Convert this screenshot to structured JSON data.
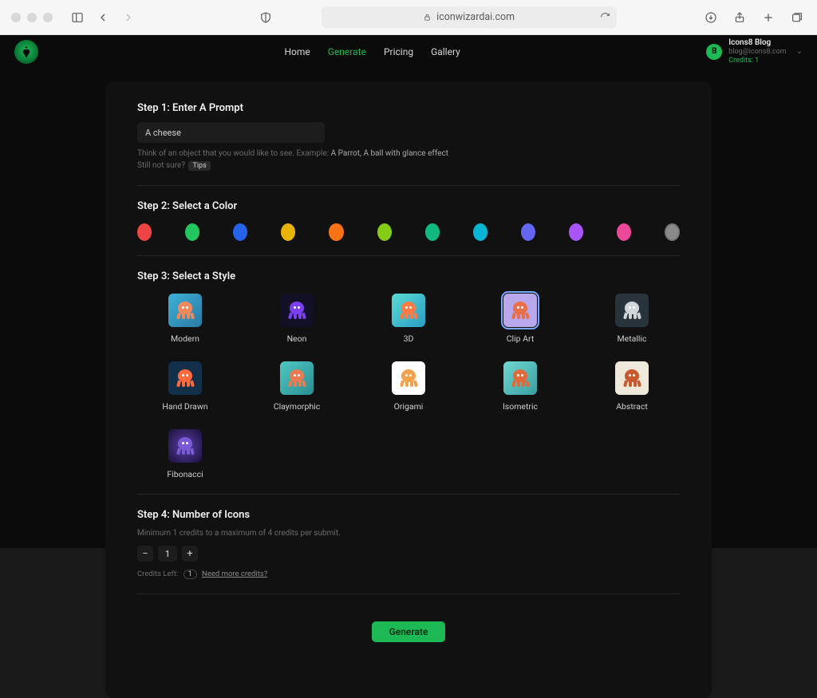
{
  "browser": {
    "url_host": "iconwizardai.com"
  },
  "nav": {
    "items": [
      {
        "label": "Home"
      },
      {
        "label": "Generate"
      },
      {
        "label": "Pricing"
      },
      {
        "label": "Gallery"
      }
    ],
    "active_index": 1
  },
  "account": {
    "avatar_initial": "B",
    "name": "Icons8 Blog",
    "email": "blog@icons8.com",
    "credits_label": "Credits: 1"
  },
  "step1": {
    "title": "Step 1: Enter A Prompt",
    "value": "A cheese",
    "hint_prefix": "Think of an object that you would like to see. Example: ",
    "hint_example": "A Parrot, A ball with glance effect",
    "still_not_sure": "Still not sure?",
    "tips_label": "Tips"
  },
  "step2": {
    "title": "Step 2: Select a Color",
    "colors": [
      "#ef4444",
      "#22c55e",
      "#2563eb",
      "#eab308",
      "#f97316",
      "#84cc16",
      "#10b981",
      "#06b6d4",
      "#6366f1",
      "#a855f7",
      "#ec4899",
      "#8a8a8a"
    ]
  },
  "step3": {
    "title": "Step 3: Select a Style",
    "selected_index": 3,
    "styles": [
      {
        "label": "Modern",
        "bg": "linear-gradient(135deg,#3fb0d6,#2a7aa6)",
        "octo": "#f08a5d"
      },
      {
        "label": "Neon",
        "bg": "#121027",
        "octo": "#7b3ff2"
      },
      {
        "label": "3D",
        "bg": "linear-gradient(135deg,#5adbd2,#2a9ec5)",
        "octo": "#ff7a45"
      },
      {
        "label": "Clip Art",
        "bg": "#b9a7ec",
        "octo": "#e96f4a"
      },
      {
        "label": "Metallic",
        "bg": "#28343a",
        "octo": "#cfd6da"
      },
      {
        "label": "Hand Drawn",
        "bg": "#12304a",
        "octo": "#ff6a3d"
      },
      {
        "label": "Claymorphic",
        "bg": "linear-gradient(135deg,#4fc8c2,#2a8e93)",
        "octo": "#e97a52"
      },
      {
        "label": "Origami",
        "bg": "#ffffff",
        "octo": "#f2a24a"
      },
      {
        "label": "Isometric",
        "bg": "linear-gradient(135deg,#6fd7cf,#3a9ea0)",
        "octo": "#e06a3a"
      },
      {
        "label": "Abstract",
        "bg": "#efe9dc",
        "octo": "#c95a2e"
      },
      {
        "label": "Fibonacci",
        "bg": "radial-gradient(circle,#5a3fa8,#1a103a)",
        "octo": "#7a5bd6"
      }
    ]
  },
  "step4": {
    "title": "Step 4: Number of Icons",
    "subtitle": "Minimum 1 credits to a maximum of 4 credits per submit.",
    "value": "1",
    "credits_left_label": "Credits Left:",
    "credits_left_value": "1",
    "need_more": "Need more credits?"
  },
  "generate_label": "Generate"
}
